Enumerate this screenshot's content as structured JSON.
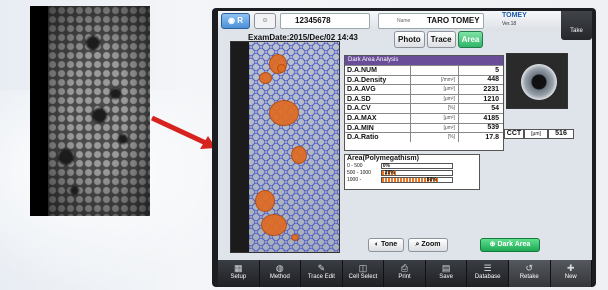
{
  "header": {
    "eye_button": "R",
    "patient_id": "12345678",
    "name_label": "Name",
    "patient_name": "TARO TOMEY",
    "brand": "TOMEY",
    "version": "Ver.18",
    "take_label": "Take"
  },
  "exam_date": "ExamDate:2015/Dec/02 14:43",
  "tabs": [
    {
      "label": "Photo",
      "active": false
    },
    {
      "label": "Trace",
      "active": false
    },
    {
      "label": "Area",
      "active": true
    }
  ],
  "analysis": {
    "title": "Dark Area Analysis",
    "rows": [
      {
        "key": "D.A.NUM",
        "unit": "",
        "value": "5"
      },
      {
        "key": "D.A.Density",
        "unit": "[/mm²]",
        "value": "448"
      },
      {
        "key": "D.A.AVG",
        "unit": "[μm²]",
        "value": "2231"
      },
      {
        "key": "D.A.SD",
        "unit": "[μm²]",
        "value": "1210"
      },
      {
        "key": "D.A.CV",
        "unit": "[%]",
        "value": "54"
      },
      {
        "key": "D.A.MAX",
        "unit": "[μm²]",
        "value": "4185"
      },
      {
        "key": "D.A.MIN",
        "unit": "[μm²]",
        "value": "539"
      },
      {
        "key": "D.A.Ratio",
        "unit": "[%]",
        "value": "17.8"
      }
    ]
  },
  "cct": {
    "label": "CCT",
    "unit": "[μm]",
    "value": "516"
  },
  "polymegathism": {
    "title": "Area(Polymegathism)",
    "rows": [
      {
        "range": "0 - 500",
        "unit": "μm²",
        "percent": 0,
        "label": "0%"
      },
      {
        "range": "500 - 1000",
        "unit": "μm²",
        "percent": 20,
        "label": "20%"
      },
      {
        "range": "1000 -",
        "unit": "μm²",
        "percent": 80,
        "label": "80%"
      }
    ]
  },
  "controls": {
    "tone": "Tone",
    "zoom": "Zoom",
    "dark_area": "Dark Area"
  },
  "toolbar": [
    "Setup",
    "Method",
    "Trace Edit",
    "Cell Select",
    "Print",
    "Save",
    "Database",
    "Retake",
    "New"
  ],
  "colors": {
    "accent_orange": "#e06b22",
    "header_purple": "#6a4d99",
    "active_green": "#2fb56a",
    "eye_blue": "#4b90d8"
  }
}
